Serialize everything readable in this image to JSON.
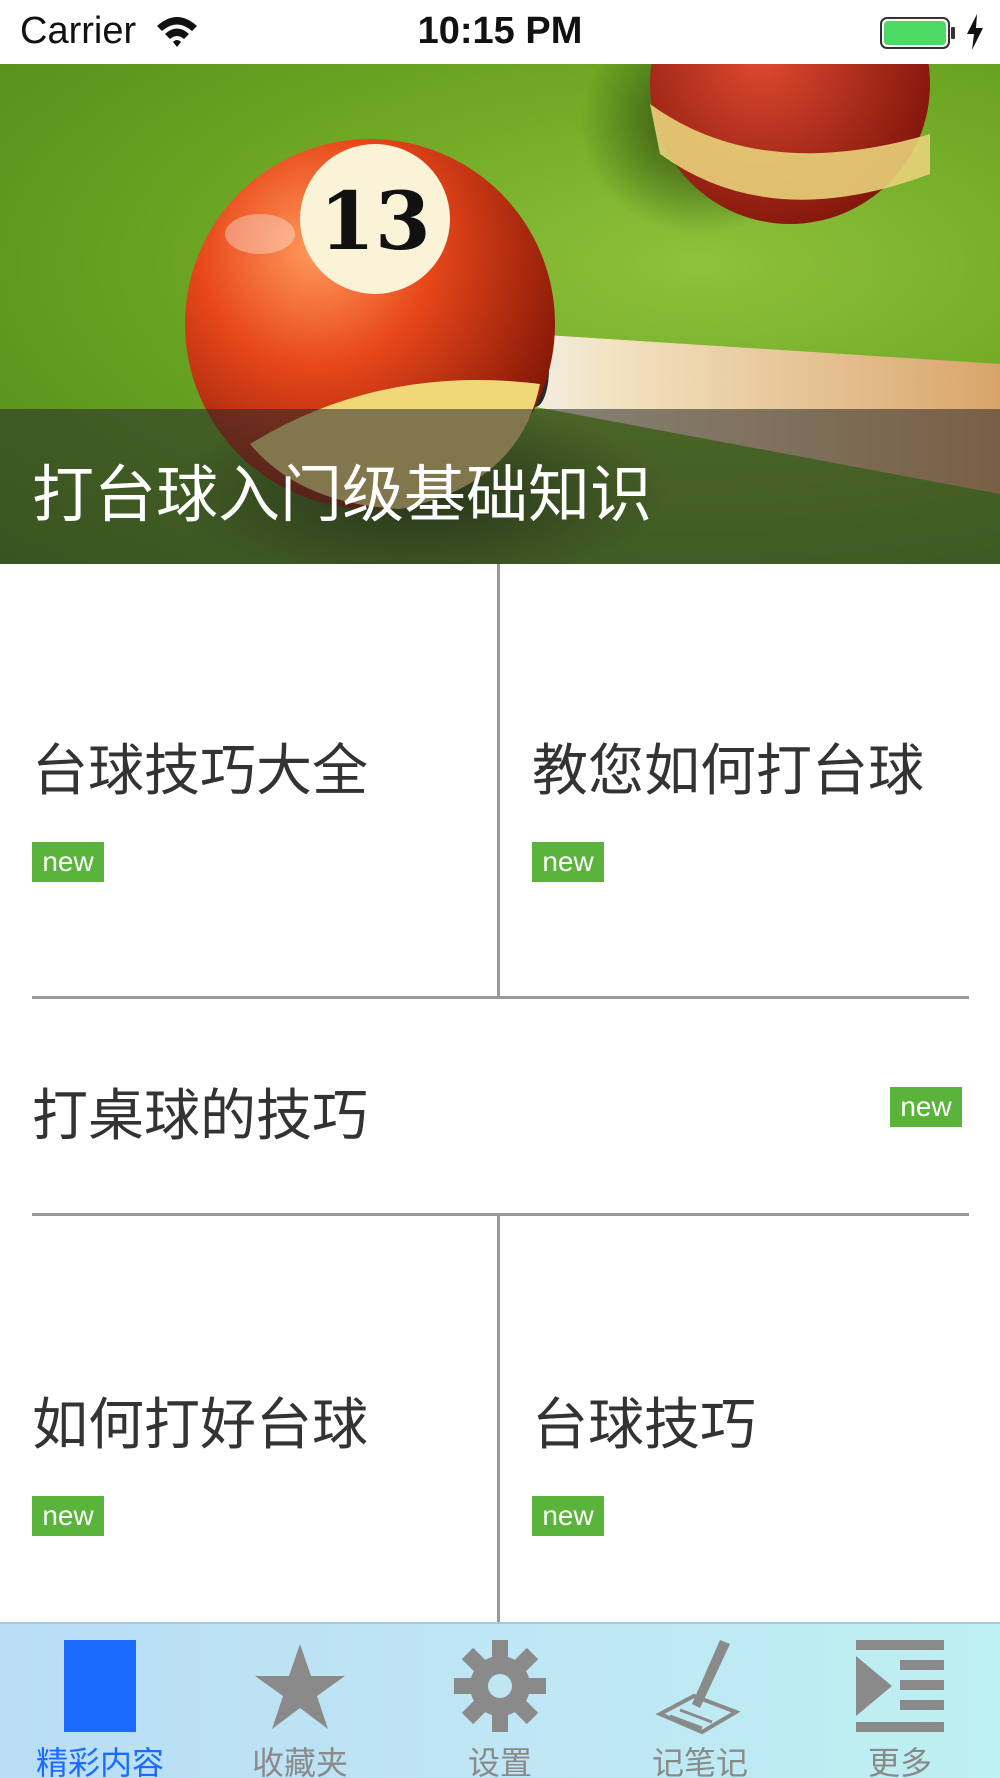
{
  "status_bar": {
    "carrier": "Carrier",
    "time": "10:15 PM"
  },
  "hero": {
    "title": "打台球入门级基础知识",
    "ball_number": "13"
  },
  "items": [
    {
      "title": "台球技巧大全",
      "badge": "new"
    },
    {
      "title": "教您如何打台球",
      "badge": "new"
    },
    {
      "title": "打桌球的技巧",
      "badge": "new"
    },
    {
      "title": "如何打好台球",
      "badge": "new"
    },
    {
      "title": "台球技巧",
      "badge": "new"
    }
  ],
  "tab_bar": {
    "tabs": [
      {
        "label": "精彩内容",
        "icon": "content-icon",
        "active": true
      },
      {
        "label": "收藏夹",
        "icon": "star-icon",
        "active": false
      },
      {
        "label": "设置",
        "icon": "gear-icon",
        "active": false
      },
      {
        "label": "记笔记",
        "icon": "pen-icon",
        "active": false
      },
      {
        "label": "更多",
        "icon": "more-icon",
        "active": false
      }
    ]
  },
  "colors": {
    "badge": "#5ab43c",
    "active_tab": "#1a6cff",
    "inactive_tab": "#8a8a8a",
    "table_green": "#6ea824"
  }
}
